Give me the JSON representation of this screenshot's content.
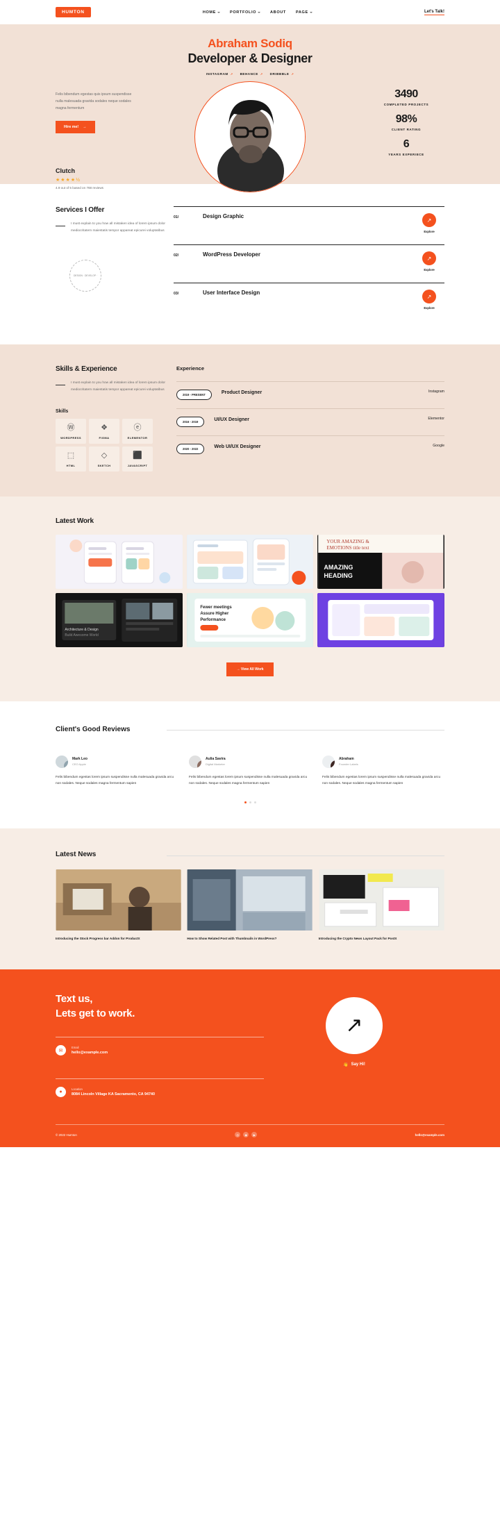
{
  "header": {
    "logo": "HUMTON",
    "nav": [
      {
        "label": "HOME",
        "caret": true
      },
      {
        "label": "PORTFOLIO",
        "caret": true
      },
      {
        "label": "ABOUT",
        "caret": false
      },
      {
        "label": "PAGE",
        "caret": true
      }
    ],
    "cta": "Let's Talk!"
  },
  "hero": {
    "name": "Abraham Sodiq",
    "title": "Developer & Designer",
    "socials": [
      {
        "label": "INSTAGRAM",
        "arrow": "↗"
      },
      {
        "label": "BEHANCE",
        "arrow": "↗"
      },
      {
        "label": "DRIBBBLE",
        "arrow": "↗"
      }
    ],
    "description": "Felis bibendum egestas quis ipsum suspendisse nulla malesuada gravida sodales neque sodales magna fermentum",
    "hire_label": "Hire me!",
    "hire_arrow": "→",
    "stats": [
      {
        "value": "3490",
        "label": "COMPLETED PROJECTS"
      },
      {
        "value": "98%",
        "label": "CLIENT RATING"
      },
      {
        "value": "6",
        "label": "YEARS EXPERIECE"
      }
    ],
    "clutch": {
      "title": "Clutch",
      "stars": "★★★★½",
      "summary": "4.9 out of 5 based on 768 reviews"
    }
  },
  "services": {
    "heading": "Services I Offer",
    "description": "I must explain to you how all mistaken idea of lorem ipsum dolor mediocritatem maiestatis tempor appareat epicurei voluptatibus",
    "badge_text": "DESIGN · DEVELOP ·",
    "explore_label": "Explore",
    "explore_arrow": "↗",
    "items": [
      {
        "num": "01/",
        "name": "Design Graphic"
      },
      {
        "num": "02/",
        "name": "WordPress Developer"
      },
      {
        "num": "03/",
        "name": "User Interface Design"
      }
    ]
  },
  "skills": {
    "heading": "Skills & Experience",
    "description": "I must explain to you how all mistaken idea of lorem ipsum dolor mediocritatem maiestatis tempor appareat epicurei voluptatibus",
    "skills_title": "Skills",
    "items": [
      {
        "name": "WORDPRESS",
        "icon": "Ⓦ"
      },
      {
        "name": "FIGMA",
        "icon": "❖"
      },
      {
        "name": "ELEMENTOR",
        "icon": "ⓔ"
      },
      {
        "name": "HTML",
        "icon": "⬚"
      },
      {
        "name": "SKETCH",
        "icon": "◇"
      },
      {
        "name": "JAVASCRIPT",
        "icon": "⬛"
      }
    ],
    "experience_title": "Experience",
    "experience": [
      {
        "period": "2019 - PRESENT",
        "role": "Product Designer",
        "company": "Instagram"
      },
      {
        "period": "2016 - 2019",
        "role": "UI/UX Designer",
        "company": "Elementor"
      },
      {
        "period": "2020 - 2022",
        "role": "Web UI/UX Designer",
        "company": "Google"
      }
    ]
  },
  "work": {
    "heading": "Latest Work",
    "view_all": "View All Work",
    "view_all_arrow": "→",
    "items": [
      {
        "name": "mobile-app-screens"
      },
      {
        "name": "dashboard-ui-kit"
      },
      {
        "name": "magazine-editorial"
      },
      {
        "name": "architecture-website"
      },
      {
        "name": "azure-performance-landing"
      },
      {
        "name": "purple-saas-dashboard"
      }
    ]
  },
  "reviews": {
    "heading": "Client's Good Reviews",
    "items": [
      {
        "name": "Mark Leo",
        "role": "CEO Apple",
        "text": "Felis bibendum egestas lorem ipsum suspendisse nulla malesuada gravida arcu non sodales. Neque sodales magna fermentum sapien"
      },
      {
        "name": "Aulia Savira",
        "role": "Digital Marketer",
        "text": "Felis bibendum egestas lorem ipsum suspendisse nulla malesuada gravida arcu non sodales. Neque sodales magna fermentum sapien"
      },
      {
        "name": "Abraham",
        "role": "Founder Labels",
        "text": "Felis bibendum egestas lorem ipsum suspendisse nulla malesuada gravida arcu non sodales. Neque sodales magna fermentum sapien"
      }
    ]
  },
  "news": {
    "heading": "Latest News",
    "items": [
      {
        "title": "Introducing the Stock Progress bar Addon for ProductX"
      },
      {
        "title": "How to Show Related Post with Thumbnails in WordPress?"
      },
      {
        "title": "Introducing the Crypto News Layout Pack for PostX"
      }
    ]
  },
  "cta": {
    "line1": "Text us,",
    "line2": "Lets get to work.",
    "email_label": "Email",
    "email_value": "hello@example.com",
    "location_label": "Location",
    "location_value": "8084 Lincoln Village KA Sacramento, CA 94740",
    "circle_arrow": "↗",
    "say_hi": "Say Hi!",
    "say_hi_icon": "👋",
    "copyright": "© 2022 Humton",
    "footer_email": "hello@example.com",
    "socials": [
      {
        "name": "instagram-icon",
        "glyph": "◎"
      },
      {
        "name": "dribbble-icon",
        "glyph": "◉"
      },
      {
        "name": "youtube-icon",
        "glyph": "▶"
      }
    ]
  },
  "colors": {
    "accent": "#F4511E",
    "hero_bg": "#F2E1D6",
    "soft_bg": "#F7EDE5"
  }
}
